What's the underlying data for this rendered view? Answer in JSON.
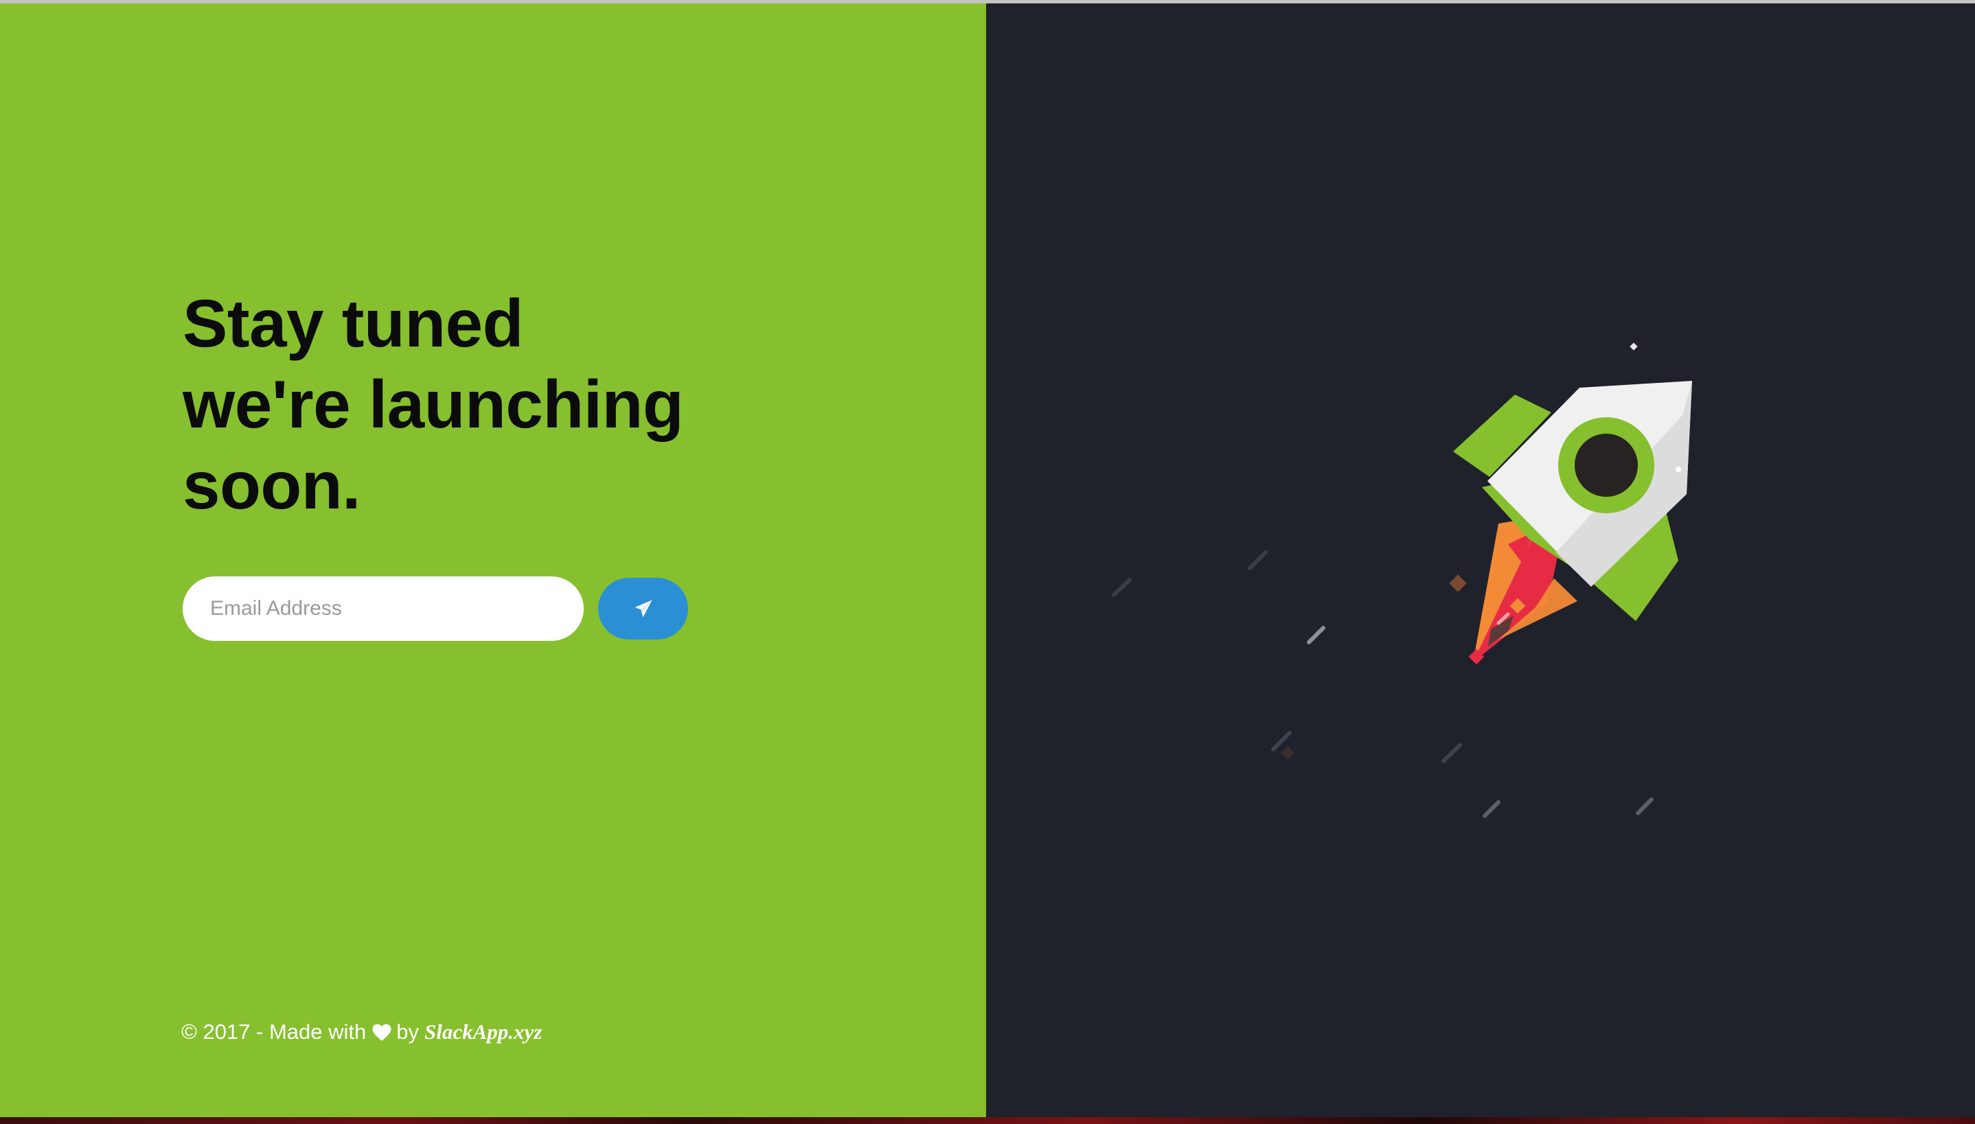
{
  "headline": {
    "line1": "Stay tuned",
    "line2": "we're launching",
    "line3": "soon."
  },
  "signup": {
    "email_placeholder": "Email Address",
    "send_icon": "paper-plane-icon"
  },
  "footer": {
    "prefix": "© 2017 - Made with",
    "heart_icon": "heart-icon",
    "by": "by",
    "brand": "SlackApp.xyz"
  },
  "illustration": {
    "subject": "rocket-icon"
  },
  "colors": {
    "left_background": "#86c02e",
    "right_background": "#1f212b",
    "button": "#2b8fd5",
    "headline": "#0b0b0b",
    "rocket_body": "#f0f0f0",
    "rocket_accent": "#86c02e",
    "flame_orange": "#f28a36",
    "flame_red": "#e72b45"
  }
}
